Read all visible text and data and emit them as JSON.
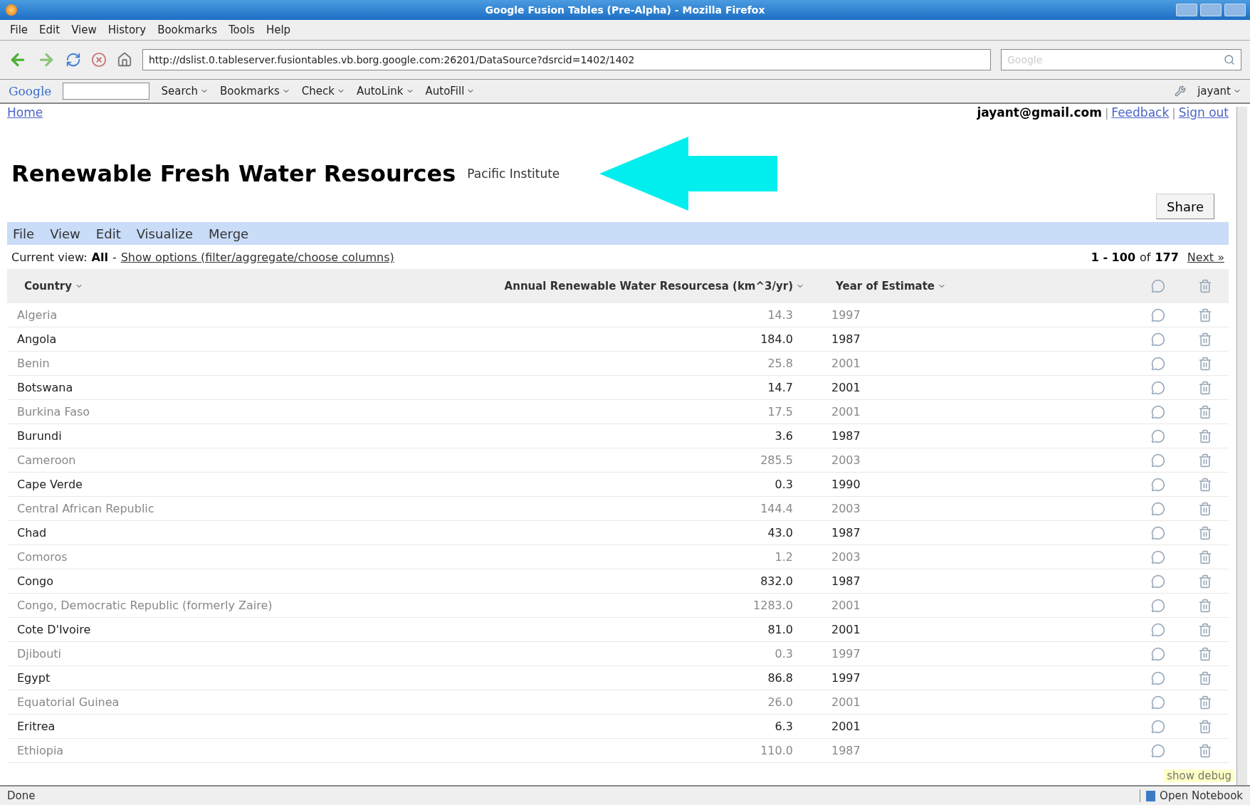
{
  "window": {
    "title": "Google Fusion Tables (Pre-Alpha) - Mozilla Firefox"
  },
  "menu": [
    "File",
    "Edit",
    "View",
    "History",
    "Bookmarks",
    "Tools",
    "Help"
  ],
  "address": {
    "url": "http://dslist.0.tableserver.fusiontables.vb.borg.google.com:26201/DataSource?dsrcid=1402/1402"
  },
  "search": {
    "placeholder": "Google"
  },
  "google_toolbar": {
    "logo": "Google",
    "items": [
      "Search",
      "Bookmarks",
      "Check",
      "AutoLink",
      "AutoFill"
    ],
    "user": "jayant"
  },
  "page": {
    "home": "Home",
    "email": "jayant@gmail.com",
    "separator": "|",
    "links": [
      "Feedback",
      "Sign out"
    ],
    "title": "Renewable Fresh Water Resources",
    "source": "Pacific Institute",
    "share": "Share",
    "menu": [
      "File",
      "View",
      "Edit",
      "Visualize",
      "Merge"
    ],
    "current_view_label": "Current view:",
    "current_view": "All",
    "dash": "-",
    "options_link": "Show options (filter/aggregate/choose columns)",
    "range": "1 - 100",
    "of": "of",
    "total": "177",
    "next": "Next »"
  },
  "table": {
    "columns": [
      "Country",
      "Annual Renewable Water Resourcesa (km^3/yr)",
      "Year of Estimate"
    ],
    "rows": [
      [
        "Algeria",
        "14.3",
        "1997"
      ],
      [
        "Angola",
        "184.0",
        "1987"
      ],
      [
        "Benin",
        "25.8",
        "2001"
      ],
      [
        "Botswana",
        "14.7",
        "2001"
      ],
      [
        "Burkina Faso",
        "17.5",
        "2001"
      ],
      [
        "Burundi",
        "3.6",
        "1987"
      ],
      [
        "Cameroon",
        "285.5",
        "2003"
      ],
      [
        "Cape Verde",
        "0.3",
        "1990"
      ],
      [
        "Central African Republic",
        "144.4",
        "2003"
      ],
      [
        "Chad",
        "43.0",
        "1987"
      ],
      [
        "Comoros",
        "1.2",
        "2003"
      ],
      [
        "Congo",
        "832.0",
        "1987"
      ],
      [
        "Congo, Democratic Republic (formerly Zaire)",
        "1283.0",
        "2001"
      ],
      [
        "Cote D'Ivoire",
        "81.0",
        "2001"
      ],
      [
        "Djibouti",
        "0.3",
        "1997"
      ],
      [
        "Egypt",
        "86.8",
        "1997"
      ],
      [
        "Equatorial Guinea",
        "26.0",
        "2001"
      ],
      [
        "Eritrea",
        "6.3",
        "2001"
      ],
      [
        "Ethiopia",
        "110.0",
        "1987"
      ]
    ]
  },
  "debug": "show debug",
  "status_bar": {
    "text": "Done",
    "notebook": "Open Notebook"
  }
}
